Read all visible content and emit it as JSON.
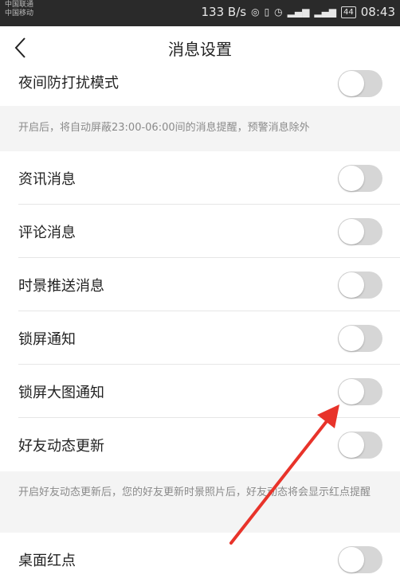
{
  "status_bar": {
    "carrier_1": "中国联通",
    "carrier_2": "中国移动",
    "net_speed": "133 B/s",
    "battery": "44",
    "time": "08:43"
  },
  "header": {
    "title": "消息设置"
  },
  "settings": {
    "night_mode": {
      "label": "夜间防打扰模式",
      "enabled": false
    },
    "night_mode_note": "开启后，将自动屏蔽23:00-06:00间的消息提醒，预警消息除外",
    "news": {
      "label": "资讯消息",
      "enabled": false
    },
    "comments": {
      "label": "评论消息",
      "enabled": false
    },
    "push": {
      "label": "时景推送消息",
      "enabled": false
    },
    "lockscreen": {
      "label": "锁屏通知",
      "enabled": false
    },
    "lockscreen_big": {
      "label": "锁屏大图通知",
      "enabled": false
    },
    "friends": {
      "label": "好友动态更新",
      "enabled": false
    },
    "friends_note": "开启好友动态更新后，您的好友更新时景照片后，好友动态将会显示红点提醒",
    "desktop_badge": {
      "label": "桌面红点",
      "enabled": false
    }
  },
  "colors": {
    "arrow": "#e8332a",
    "toggle_off": "#d6d6d6"
  }
}
